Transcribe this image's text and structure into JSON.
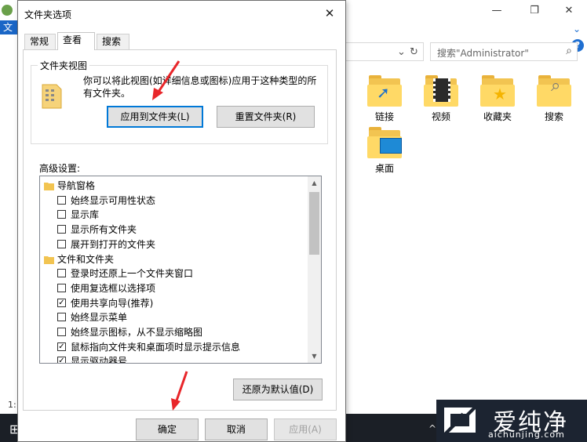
{
  "explorer": {
    "ribbon_tab": "文",
    "controls": {
      "minimize": "—",
      "maximize": "❐",
      "close": "✕"
    },
    "chevron": "⌄",
    "help": "?",
    "address_controls": {
      "dropdown": "⌄",
      "refresh": "↻"
    },
    "search_placeholder": "搜索\"Administrator\"",
    "search_icon": "search-icon",
    "folders": [
      {
        "label": "链接",
        "icon": "link-folder-icon"
      },
      {
        "label": "视频",
        "icon": "video-folder-icon"
      },
      {
        "label": "收藏夹",
        "icon": "favorites-folder-icon"
      },
      {
        "label": "搜索",
        "icon": "search-folder-icon"
      },
      {
        "label": "桌面",
        "icon": "desktop-folder-icon"
      }
    ],
    "side_count": "1:",
    "taskbar": {
      "start_glyph": "⊞",
      "tray_up": "^"
    }
  },
  "watermark": {
    "cn": "爱纯净",
    "url": "aichunjing.com"
  },
  "dialog": {
    "title": "文件夹选项",
    "close_glyph": "✕",
    "tabs": [
      {
        "label": "常规",
        "active": false
      },
      {
        "label": "查看",
        "active": true
      },
      {
        "label": "搜索",
        "active": false
      }
    ],
    "folder_views": {
      "legend": "文件夹视图",
      "description": "你可以将此视图(如详细信息或图标)应用于这种类型的所有文件夹。",
      "apply_button": "应用到文件夹(L)",
      "reset_button": "重置文件夹(R)"
    },
    "advanced_label": "高级设置:",
    "advanced_items": [
      {
        "type": "group",
        "label": "导航窗格",
        "icon": "nav-pane-icon"
      },
      {
        "type": "checkbox",
        "label": "始终显示可用性状态",
        "checked": false
      },
      {
        "type": "checkbox",
        "label": "显示库",
        "checked": false
      },
      {
        "type": "checkbox",
        "label": "显示所有文件夹",
        "checked": false
      },
      {
        "type": "checkbox",
        "label": "展开到打开的文件夹",
        "checked": false
      },
      {
        "type": "group",
        "label": "文件和文件夹",
        "icon": "folder-icon"
      },
      {
        "type": "checkbox",
        "label": "登录时还原上一个文件夹窗口",
        "checked": false
      },
      {
        "type": "checkbox",
        "label": "使用复选框以选择项",
        "checked": false
      },
      {
        "type": "checkbox",
        "label": "使用共享向导(推荐)",
        "checked": true
      },
      {
        "type": "checkbox",
        "label": "始终显示菜单",
        "checked": false
      },
      {
        "type": "checkbox",
        "label": "始终显示图标，从不显示缩略图",
        "checked": false
      },
      {
        "type": "checkbox",
        "label": "鼠标指向文件夹和桌面项时显示提示信息",
        "checked": true
      },
      {
        "type": "checkbox",
        "label": "显示驱动器号",
        "checked": true
      }
    ],
    "check_glyph": "✓",
    "scroll_up": "▲",
    "scroll_down": "▼",
    "restore_defaults": "还原为默认值(D)",
    "ok": "确定",
    "cancel": "取消",
    "apply": "应用(A)"
  },
  "annotation_color": "#e8262a"
}
